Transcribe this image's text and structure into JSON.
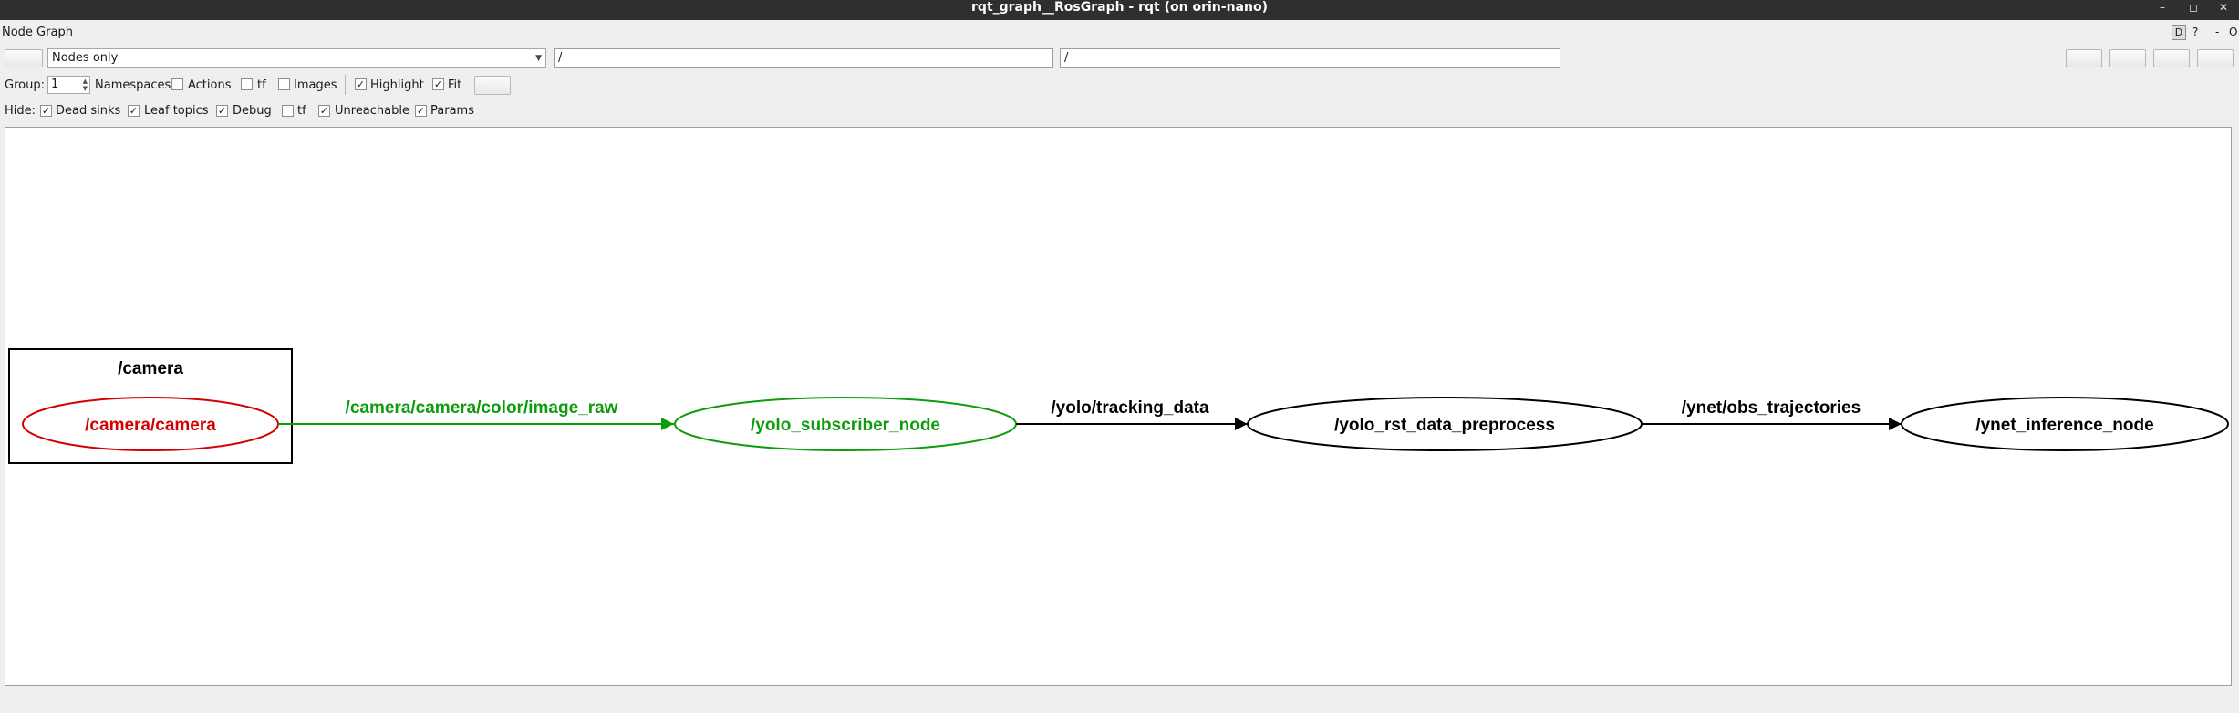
{
  "window": {
    "title": "rqt_graph__RosGraph - rqt (on orin-nano)",
    "controls": [
      "–",
      "◻",
      "✕"
    ]
  },
  "plugin": {
    "title": "Node Graph",
    "dock_controls": {
      "d": "D",
      "help": "?",
      "minus": "-",
      "close": "O"
    }
  },
  "toolbar": {
    "graph_mode": "Nodes only",
    "node_filter": "/",
    "topic_filter": "/"
  },
  "options": {
    "group_label": "Group:",
    "group_value": "1",
    "namespaces": {
      "label": "Namespaces",
      "checked": false
    },
    "actions": {
      "label": "Actions",
      "checked": false
    },
    "tf": {
      "label": "tf",
      "checked": false
    },
    "images": {
      "label": "Images",
      "checked": false
    },
    "highlight": {
      "label": "Highlight",
      "checked": true
    },
    "fit": {
      "label": "Fit",
      "checked": true
    }
  },
  "hide": {
    "label": "Hide:",
    "dead_sinks": {
      "label": "Dead sinks",
      "checked": true
    },
    "leaf_topics": {
      "label": "Leaf topics",
      "checked": true
    },
    "debug": {
      "label": "Debug",
      "checked": true
    },
    "tf": {
      "label": "tf",
      "checked": false
    },
    "unreachable": {
      "label": "Unreachable",
      "checked": true
    },
    "params": {
      "label": "Params",
      "checked": true
    }
  },
  "graph": {
    "cluster": "/camera",
    "nodes": {
      "camera": "/camera/camera",
      "yolo_subscriber": "/yolo_subscriber_node",
      "preprocess": "/yolo_rst_data_preprocess",
      "inference": "/ynet_inference_node"
    },
    "edges": {
      "image_raw": "/camera/camera/color/image_raw",
      "tracking_data": "/yolo/tracking_data",
      "obs_trajectories": "/ynet/obs_trajectories"
    },
    "colors": {
      "publisher": "#d30000",
      "highlight": "#0c9c0c",
      "default": "#000000"
    }
  }
}
